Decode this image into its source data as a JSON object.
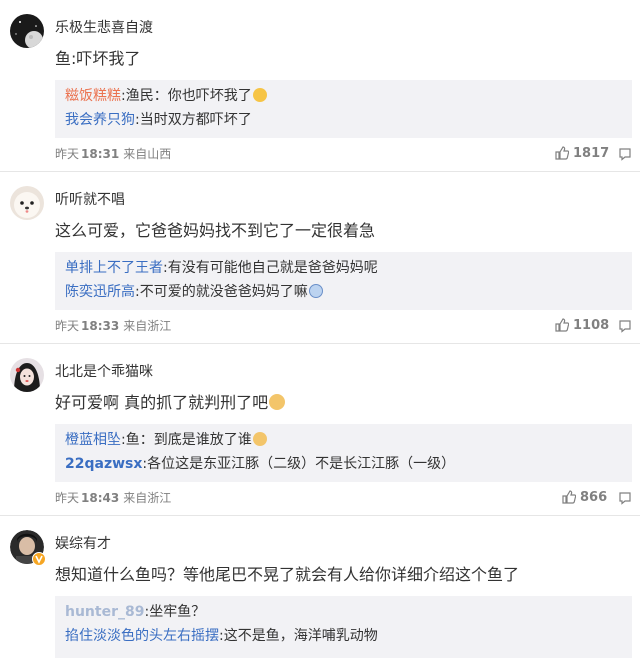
{
  "comments": [
    {
      "username": "乐极生悲喜自渡",
      "text": "鱼:吓坏我了",
      "replies": [
        {
          "user": "糍饭糕糕",
          "sep": ":",
          "text": "渔民：你也吓坏我了",
          "has_emoji": true
        },
        {
          "user": "我会养只狗",
          "sep": ":",
          "text": "当时双方都吓坏了",
          "has_emoji": false
        }
      ],
      "date": "昨天",
      "time": "18:31",
      "source": "来自山西",
      "likes": "1817"
    },
    {
      "username": "听听就不唱",
      "text": "这么可爱，它爸爸妈妈找不到它了一定很着急",
      "replies": [
        {
          "user": "单排上不了王者",
          "sep": ":",
          "text": "有没有可能他自己就是爸爸妈妈呢",
          "has_emoji": false
        },
        {
          "user": "陈奕迅所高",
          "sep": ":",
          "text": "不可爱的就没爸爸妈妈了嘛",
          "has_emoji": true
        }
      ],
      "date": "昨天",
      "time": "18:33",
      "source": "来自浙江",
      "likes": "1108"
    },
    {
      "username": "北北是个乖猫咪",
      "text": "好可爱啊 真的抓了就判刑了吧",
      "text_emoji": true,
      "replies": [
        {
          "user": "橙蓝相坠",
          "sep": ":",
          "text": "鱼：到底是谁放了谁",
          "has_emoji": true
        },
        {
          "user": "22qazwsx",
          "sep": ":",
          "text": "各位这是东亚江豚（二级）不是长江江豚（一级）",
          "has_emoji": false
        }
      ],
      "date": "昨天",
      "time": "18:43",
      "source": "来自浙江",
      "likes": "866"
    },
    {
      "username": "娱综有才",
      "text": "想知道什么鱼吗？等他尾巴不晃了就会有人给你详细介绍这个鱼了",
      "replies": [
        {
          "user": "hunter_89",
          "sep": ":",
          "text": "坐牢鱼？",
          "has_emoji": false
        },
        {
          "user": "掐住淡淡色的头左右摇摆",
          "sep": ":",
          "text": "这不是鱼，海洋哺乳动物",
          "has_emoji": false
        }
      ]
    }
  ],
  "icons": {
    "like": "thumbs-up-icon",
    "reply": "comment-bubble-icon"
  },
  "colors": {
    "username_reply": "#eb7350",
    "username_reply_alt": "#3a6ec2",
    "meta": "#808080",
    "reply_bg": "#f2f2f5"
  }
}
